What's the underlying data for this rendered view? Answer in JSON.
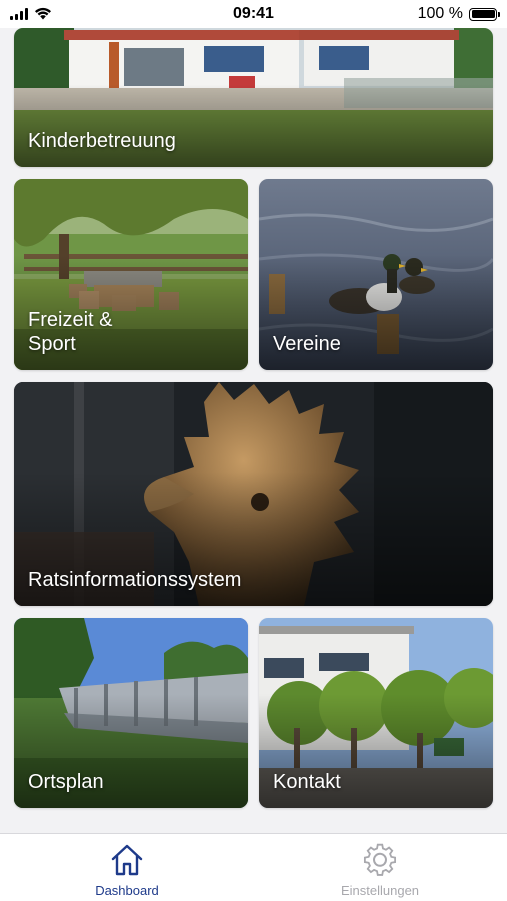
{
  "status_bar": {
    "time": "09:41",
    "battery_text": "100 %",
    "battery_level": 1.0
  },
  "tiles": {
    "kinderbetreuung": "Kinderbetreuung",
    "freizeit_line1": "Freizeit &",
    "freizeit_line2": "Sport",
    "vereine": "Vereine",
    "ratsinformationssystem": "Ratsinformationssystem",
    "ortsplan": "Ortsplan",
    "kontakt": "Kontakt"
  },
  "tab_bar": {
    "dashboard_label": "Dashboard",
    "settings_label": "Einstellungen",
    "active_color": "#1e3a8a",
    "inactive_color": "#a8a8ad",
    "active_tab": "Dashboard"
  },
  "icons": {
    "dashboard": "house-icon",
    "settings": "gear-icon"
  }
}
